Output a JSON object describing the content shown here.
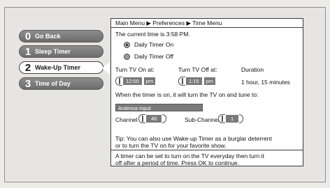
{
  "menu": {
    "items": [
      {
        "num": "0",
        "label": "Go Back"
      },
      {
        "num": "1",
        "label": "Sleep Timer"
      },
      {
        "num": "2",
        "label": "Wake-Up Timer"
      },
      {
        "num": "3",
        "label": "Time of Day"
      }
    ],
    "active_index": 2
  },
  "panel": {
    "breadcrumb": "Main Menu ▶ Preferences ▶ Time Menu",
    "current_time": "The current time is 3:58 PM.",
    "radio_on_label": "Daily Timer On",
    "radio_off_label": "Daily Timer Off",
    "selected_radio": "Daily Timer On",
    "turn_on_label": "Turn TV On at:",
    "turn_off_label": "Turn TV Off at:",
    "duration_label": "Duration",
    "on_time": "12:00",
    "on_ampm": "pm",
    "off_time": "1:15",
    "off_ampm": "pm",
    "duration_value": "1 hour, 15 minutes",
    "tune_text": "When the timer is on, it will turn the TV on and tune to:",
    "input_value": "Antenna Input",
    "channel_label": "Channel",
    "channel_value": "46",
    "subchannel_label": "Sub-Channel",
    "subchannel_value": "1",
    "tip_line1": "Tip: You can also use Wake-up Timer as a burglar deterrent",
    "tip_line2": "or to turn the TV on for your favorite show.",
    "help_line1": "A timer can be set to turn on the TV everyday then turn it",
    "help_line2": "off after a period of time. Press OK to continue."
  }
}
